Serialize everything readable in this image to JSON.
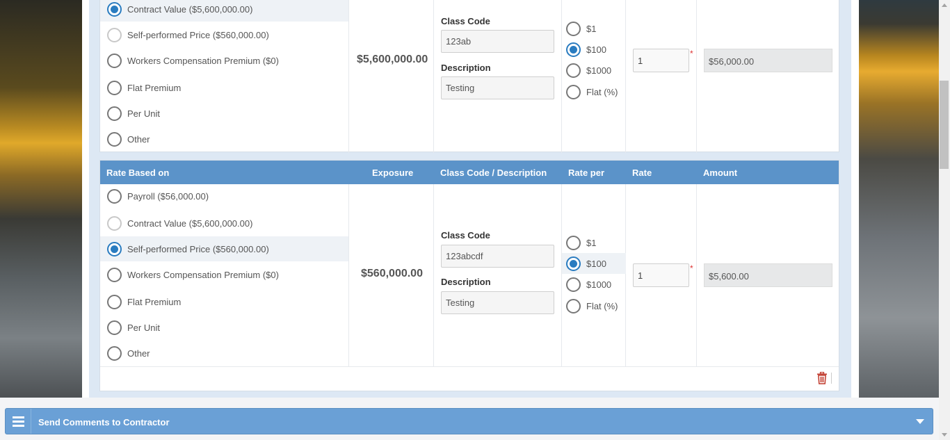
{
  "block1": {
    "options": [
      {
        "label": "Contract Value ($5,600,000.00)",
        "state": "checked"
      },
      {
        "label": "Self-performed Price ($560,000.00)",
        "state": "disabled"
      },
      {
        "label": "Workers Compensation Premium ($0)",
        "state": "unchecked"
      },
      {
        "label": "Flat Premium",
        "state": "unchecked"
      },
      {
        "label": "Per Unit",
        "state": "unchecked"
      },
      {
        "label": "Other",
        "state": "unchecked"
      }
    ],
    "exposure": "$5,600,000.00",
    "class_code_label": "Class Code",
    "class_code_value": "123ab",
    "description_label": "Description",
    "description_value": "Testing",
    "rate_per": [
      {
        "label": "$1",
        "state": "unchecked"
      },
      {
        "label": "$100",
        "state": "checked"
      },
      {
        "label": "$1000",
        "state": "unchecked"
      },
      {
        "label": "Flat (%)",
        "state": "unchecked"
      }
    ],
    "rate_value": "1",
    "required_mark": "*",
    "amount": "$56,000.00"
  },
  "block2": {
    "headers": {
      "rate_based_on": "Rate Based on",
      "exposure": "Exposure",
      "class_code_description": "Class Code / Description",
      "rate_per": "Rate per",
      "rate": "Rate",
      "amount": "Amount"
    },
    "options": [
      {
        "label": "Payroll ($56,000.00)",
        "state": "unchecked"
      },
      {
        "label": "Contract Value ($5,600,000.00)",
        "state": "disabled"
      },
      {
        "label": "Self-performed Price ($560,000.00)",
        "state": "checked"
      },
      {
        "label": "Workers Compensation Premium ($0)",
        "state": "unchecked"
      },
      {
        "label": "Flat Premium",
        "state": "unchecked"
      },
      {
        "label": "Per Unit",
        "state": "unchecked"
      },
      {
        "label": "Other",
        "state": "unchecked"
      }
    ],
    "exposure": "$560,000.00",
    "class_code_label": "Class Code",
    "class_code_value": "123abcdf",
    "description_label": "Description",
    "description_value": "Testing",
    "rate_per": [
      {
        "label": "$1",
        "state": "unchecked"
      },
      {
        "label": "$100",
        "state": "checked"
      },
      {
        "label": "$1000",
        "state": "unchecked"
      },
      {
        "label": "Flat (%)",
        "state": "unchecked"
      }
    ],
    "rate_value": "1",
    "required_mark": "*",
    "amount": "$5,600.00"
  },
  "comments_bar": {
    "title": "Send Comments to Contractor"
  },
  "colors": {
    "header_blue": "#5b93c9",
    "radio_blue": "#2a7cc0",
    "bar_blue": "#6aa0d6",
    "trash_red": "#c0392b"
  },
  "icons": [
    "menu-icon",
    "chevron-down-icon",
    "trash-icon"
  ]
}
